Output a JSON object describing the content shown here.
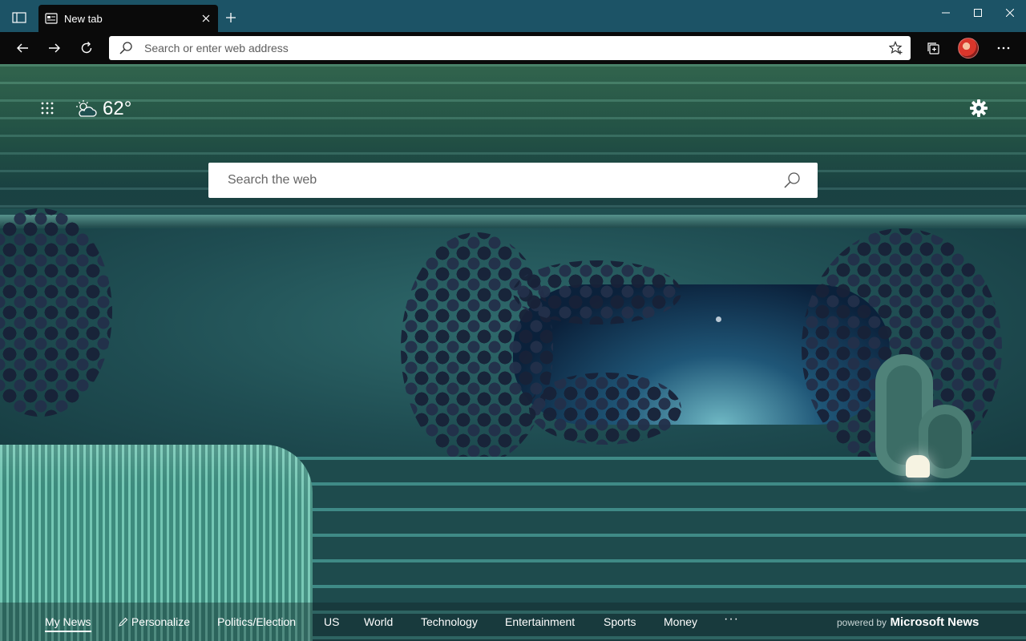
{
  "browser": {
    "tab": {
      "title": "New tab"
    },
    "address_bar": {
      "placeholder": "Search or enter web address"
    }
  },
  "page": {
    "weather": {
      "temperature": "62°",
      "condition_icon": "partly-cloudy-icon"
    },
    "web_search": {
      "placeholder": "Search the web"
    }
  },
  "news_bar": {
    "items": [
      "My News",
      "Personalize",
      "Politics/Election",
      "US",
      "World",
      "Technology",
      "Entertainment",
      "Sports",
      "Money"
    ],
    "active": "My News",
    "more_label": "···",
    "powered_by": "powered by",
    "brand": "Microsoft News"
  },
  "colors": {
    "titlebar": "#1c5366",
    "toolbar": "#0a0a0a",
    "accent": "#ffffff"
  }
}
